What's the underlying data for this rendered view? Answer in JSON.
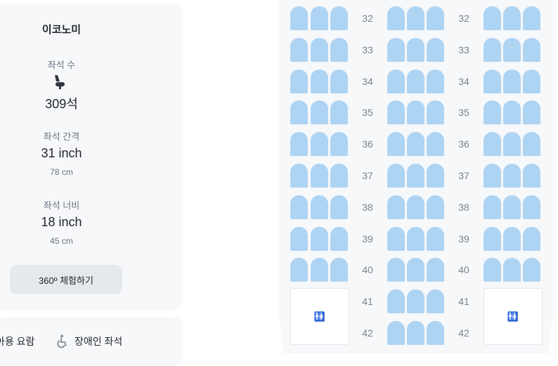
{
  "cabin": {
    "title": "이코노미",
    "seat_count_label": "좌석 수",
    "seat_count_value": "309석",
    "pitch_label": "좌석 간격",
    "pitch_value": "31 inch",
    "pitch_sub": "78 cm",
    "width_label": "좌석 너비",
    "width_value": "18 inch",
    "width_sub": "45 cm",
    "vr_button_label": "360º 체험하기"
  },
  "legend": {
    "item1_label": "아용 요람",
    "item2_label": "장애인 좌석",
    "item2_icon": "wheelchair-icon"
  },
  "seat_map": {
    "seat_color": "#aed4f3",
    "rows": [
      "32",
      "33",
      "34",
      "35",
      "36",
      "37",
      "38",
      "39",
      "40"
    ],
    "lav_rows": [
      "41",
      "42"
    ],
    "lavatory_icon": "lavatory-icon",
    "lavatory_symbol": "🚻"
  }
}
